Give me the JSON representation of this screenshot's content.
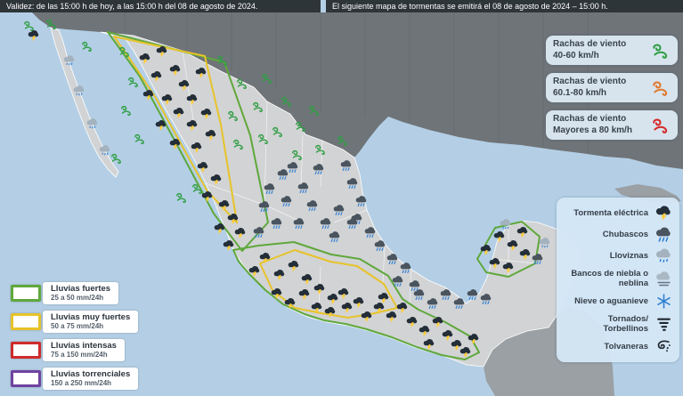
{
  "header": {
    "left": "Validez: de las 15:00 h de hoy, a las 15:00 h del 08 de agosto de 2024.",
    "right": "El siguiente mapa de tormentas se emitirá el 08 de agosto de 2024 – 15:00 h."
  },
  "wind_legend": {
    "items": [
      {
        "title": "Rachas de viento",
        "range": "40-60 km/h",
        "color": "#2f9e44"
      },
      {
        "title": "Rachas de viento",
        "range": "60.1-80 km/h",
        "color": "#e17a2d"
      },
      {
        "title": "Rachas de viento",
        "range": "Mayores a 80 km/h",
        "color": "#d62828"
      }
    ]
  },
  "weather_legend": {
    "items": [
      {
        "label": "Tormenta eléctrica",
        "icon": "storm"
      },
      {
        "label": "Chubascos",
        "icon": "shower"
      },
      {
        "label": "Lloviznas",
        "icon": "drizzle"
      },
      {
        "label": "Bancos de niebla o neblina",
        "icon": "fog"
      },
      {
        "label": "Nieve o aguanieve",
        "icon": "snow"
      },
      {
        "label": "Tornados/\nTorbellinos",
        "icon": "tornado"
      },
      {
        "label": "Tolvaneras",
        "icon": "dust"
      }
    ]
  },
  "rain_legend": {
    "items": [
      {
        "title": "Lluvias fuertes",
        "range": "25 a 50 mm/24h",
        "color": "#5fa83c"
      },
      {
        "title": "Lluvias muy fuertes",
        "range": "50 a 75 mm/24h",
        "color": "#e7c32a"
      },
      {
        "title": "Lluvias intensas",
        "range": "75 a 150 mm/24h",
        "color": "#cf2b2b"
      },
      {
        "title": "Lluvias torrenciales",
        "range": "150 a 250 mm/24h",
        "color": "#6f42a0"
      }
    ]
  },
  "map": {
    "colors": {
      "ocean": "#b4cfe5",
      "us_land": "#6f7478",
      "mexico_land": "#d2d3d4",
      "neighbor_land": "#9aa0a4"
    },
    "markers": [
      [
        "w",
        33,
        29
      ],
      [
        "w",
        58,
        27
      ],
      [
        "w",
        98,
        52
      ],
      [
        "w",
        140,
        58
      ],
      [
        "w",
        150,
        92
      ],
      [
        "w",
        142,
        124
      ],
      [
        "w",
        157,
        156
      ],
      [
        "w",
        131,
        178
      ],
      [
        "w",
        250,
        68
      ],
      [
        "w",
        272,
        94
      ],
      [
        "w",
        300,
        88
      ],
      [
        "w",
        290,
        120
      ],
      [
        "w",
        322,
        114
      ],
      [
        "w",
        262,
        130
      ],
      [
        "w",
        268,
        162
      ],
      [
        "w",
        296,
        156
      ],
      [
        "w",
        338,
        142
      ],
      [
        "w",
        312,
        148
      ],
      [
        "w",
        334,
        174
      ],
      [
        "w",
        360,
        168
      ],
      [
        "w",
        385,
        158
      ],
      [
        "w",
        353,
        124
      ],
      [
        "w",
        222,
        212
      ],
      [
        "w",
        204,
        222
      ],
      [
        "s",
        38,
        40
      ],
      [
        "s",
        163,
        66
      ],
      [
        "s",
        182,
        58
      ],
      [
        "s",
        176,
        86
      ],
      [
        "s",
        197,
        79
      ],
      [
        "s",
        167,
        107
      ],
      [
        "s",
        188,
        112
      ],
      [
        "s",
        207,
        96
      ],
      [
        "s",
        201,
        127
      ],
      [
        "s",
        181,
        141
      ],
      [
        "s",
        216,
        141
      ],
      [
        "s",
        197,
        162
      ],
      [
        "s",
        221,
        166
      ],
      [
        "s",
        237,
        152
      ],
      [
        "s",
        232,
        128
      ],
      [
        "s",
        216,
        112
      ],
      [
        "s",
        226,
        82
      ],
      [
        "s",
        228,
        188
      ],
      [
        "s",
        243,
        202
      ],
      [
        "s",
        233,
        221
      ],
      [
        "s",
        252,
        231
      ],
      [
        "s",
        262,
        246
      ],
      [
        "s",
        247,
        257
      ],
      [
        "s",
        270,
        262
      ],
      [
        "s",
        257,
        276
      ],
      [
        "s",
        298,
        290
      ],
      [
        "s",
        286,
        305
      ],
      [
        "s",
        314,
        309
      ],
      [
        "s",
        330,
        299
      ],
      [
        "s",
        345,
        314
      ],
      [
        "s",
        311,
        330
      ],
      [
        "s",
        326,
        341
      ],
      [
        "s",
        342,
        331
      ],
      [
        "s",
        359,
        325
      ],
      [
        "s",
        356,
        346
      ],
      [
        "s",
        374,
        336
      ],
      [
        "s",
        371,
        351
      ],
      [
        "s",
        390,
        346
      ],
      [
        "s",
        386,
        330
      ],
      [
        "s",
        403,
        340
      ],
      [
        "s",
        412,
        356
      ],
      [
        "s",
        426,
        346
      ],
      [
        "s",
        440,
        356
      ],
      [
        "s",
        431,
        335
      ],
      [
        "s",
        452,
        346
      ],
      [
        "s",
        463,
        362
      ],
      [
        "s",
        477,
        372
      ],
      [
        "s",
        492,
        362
      ],
      [
        "s",
        503,
        377
      ],
      [
        "s",
        513,
        388
      ],
      [
        "s",
        523,
        396
      ],
      [
        "s",
        532,
        381
      ],
      [
        "s",
        482,
        387
      ],
      [
        "s",
        546,
        281
      ],
      [
        "s",
        561,
        266
      ],
      [
        "s",
        576,
        276
      ],
      [
        "s",
        590,
        286
      ],
      [
        "s",
        556,
        296
      ],
      [
        "s",
        571,
        301
      ],
      [
        "s",
        587,
        261
      ],
      [
        "r",
        329,
        188
      ],
      [
        "r",
        358,
        190
      ],
      [
        "r",
        389,
        186
      ],
      [
        "r",
        396,
        206
      ],
      [
        "r",
        406,
        226
      ],
      [
        "r",
        401,
        246
      ],
      [
        "r",
        416,
        261
      ],
      [
        "r",
        427,
        276
      ],
      [
        "r",
        441,
        291
      ],
      [
        "r",
        456,
        301
      ],
      [
        "r",
        447,
        316
      ],
      [
        "r",
        466,
        321
      ],
      [
        "r",
        303,
        212
      ],
      [
        "r",
        318,
        196
      ],
      [
        "r",
        297,
        232
      ],
      [
        "r",
        322,
        226
      ],
      [
        "r",
        341,
        211
      ],
      [
        "r",
        351,
        231
      ],
      [
        "r",
        336,
        251
      ],
      [
        "r",
        311,
        251
      ],
      [
        "r",
        291,
        261
      ],
      [
        "r",
        366,
        251
      ],
      [
        "r",
        381,
        236
      ],
      [
        "r",
        396,
        251
      ],
      [
        "r",
        376,
        266
      ],
      [
        "r",
        471,
        331
      ],
      [
        "r",
        486,
        341
      ],
      [
        "r",
        501,
        331
      ],
      [
        "r",
        516,
        341
      ],
      [
        "r",
        531,
        331
      ],
      [
        "r",
        546,
        336
      ],
      [
        "r",
        604,
        291
      ],
      [
        "d",
        78,
        68
      ],
      [
        "d",
        89,
        102
      ],
      [
        "d",
        104,
        139
      ],
      [
        "d",
        118,
        169
      ],
      [
        "d",
        568,
        252
      ],
      [
        "d",
        612,
        273
      ]
    ]
  }
}
